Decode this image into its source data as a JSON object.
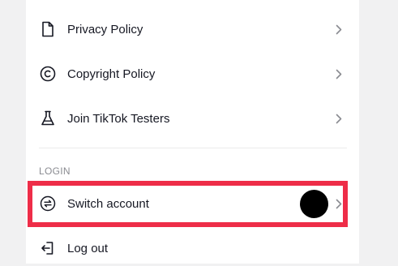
{
  "settings_list": {
    "items": [
      {
        "label": "Privacy Policy",
        "icon": "document-icon"
      },
      {
        "label": "Copyright Policy",
        "icon": "copyright-icon"
      },
      {
        "label": "Join TikTok Testers",
        "icon": "flask-icon"
      }
    ],
    "login_section": {
      "header": "LOGIN",
      "items": [
        {
          "label": "Switch account",
          "icon": "switch-arrows-icon"
        },
        {
          "label": "Log out",
          "icon": "logout-icon"
        }
      ]
    }
  },
  "colors": {
    "background": "#f1f1f2",
    "panel": "#ffffff",
    "text": "#161823",
    "muted_text": "#8a8b91",
    "highlight_border": "#ee2d48",
    "overlay_dot": "#000000"
  }
}
